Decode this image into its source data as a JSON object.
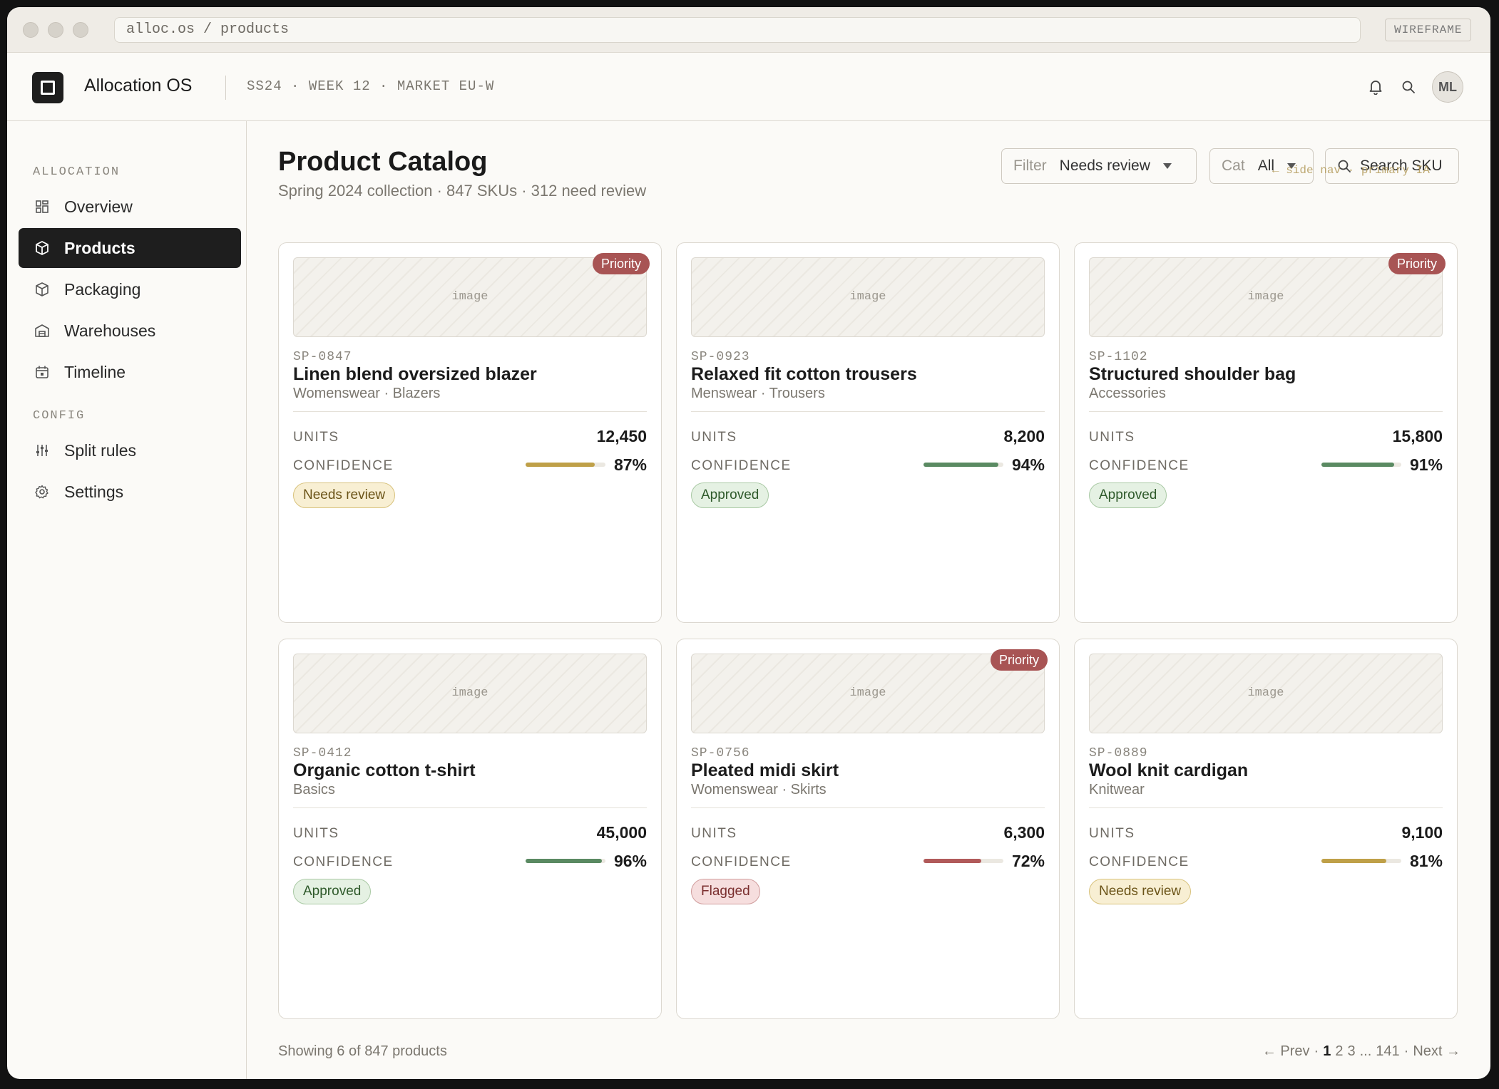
{
  "browser": {
    "url": "alloc.os / products",
    "tag": "WIREFRAME"
  },
  "header": {
    "app_name": "Allocation OS",
    "context": "SS24 · WEEK 12 · MARKET EU-W",
    "avatar_initials": "ML",
    "icons": [
      "bell-icon",
      "search-icon"
    ]
  },
  "sidebar": {
    "sections": [
      {
        "label": "ALLOCATION",
        "items": [
          {
            "label": "Overview",
            "icon": "grid-icon",
            "active": false
          },
          {
            "label": "Products",
            "icon": "box-icon",
            "active": true
          },
          {
            "label": "Packaging",
            "icon": "package-icon",
            "active": false
          },
          {
            "label": "Warehouses",
            "icon": "warehouse-icon",
            "active": false
          },
          {
            "label": "Timeline",
            "icon": "calendar-icon",
            "active": false
          }
        ]
      },
      {
        "label": "CONFIG",
        "items": [
          {
            "label": "Split rules",
            "icon": "sliders-icon",
            "active": false
          },
          {
            "label": "Settings",
            "icon": "gear-icon",
            "active": false
          }
        ]
      }
    ]
  },
  "main": {
    "title": "Product Catalog",
    "subtitle": "Spring 2024 collection · 847 SKUs · 312 need review",
    "filter": {
      "label": "Filter",
      "value": "Needs review"
    },
    "category": {
      "label": "Cat",
      "value": "All"
    },
    "search": {
      "placeholder": "Search SKU"
    },
    "annotation": "← side nav · primary IA",
    "units_label": "UNITS",
    "confidence_label": "CONFIDENCE",
    "image_label": "image",
    "priority_label": "Priority",
    "products": [
      {
        "sku": "SP-0847",
        "name": "Linen blend oversized blazer",
        "category": "Womenswear · Blazers",
        "units": "12,450",
        "confidence": 87,
        "confidence_text": "87%",
        "status": "Needs review",
        "priority": true
      },
      {
        "sku": "SP-0923",
        "name": "Relaxed fit cotton trousers",
        "category": "Menswear · Trousers",
        "units": "8,200",
        "confidence": 94,
        "confidence_text": "94%",
        "status": "Approved",
        "priority": false
      },
      {
        "sku": "SP-1102",
        "name": "Structured shoulder bag",
        "category": "Accessories",
        "units": "15,800",
        "confidence": 91,
        "confidence_text": "91%",
        "status": "Approved",
        "priority": true
      },
      {
        "sku": "SP-0412",
        "name": "Organic cotton t-shirt",
        "category": "Basics",
        "units": "45,000",
        "confidence": 96,
        "confidence_text": "96%",
        "status": "Approved",
        "priority": false
      },
      {
        "sku": "SP-0756",
        "name": "Pleated midi skirt",
        "category": "Womenswear · Skirts",
        "units": "6,300",
        "confidence": 72,
        "confidence_text": "72%",
        "status": "Flagged",
        "priority": true
      },
      {
        "sku": "SP-0889",
        "name": "Wool knit cardigan",
        "category": "Knitwear",
        "units": "9,100",
        "confidence": 81,
        "confidence_text": "81%",
        "status": "Needs review",
        "priority": false
      }
    ],
    "status_colors": {
      "Needs review": {
        "bg": "#f8efd3",
        "border": "#d8c27c",
        "text": "#6b5418",
        "bar": "#bfa048"
      },
      "Approved": {
        "bg": "#e5f1e3",
        "border": "#a9c9a4",
        "text": "#2f5a2b",
        "bar": "#5a8a62"
      },
      "Flagged": {
        "bg": "#f6dede",
        "border": "#d09d9d",
        "text": "#7a2e2e",
        "bar": "#b15a5a"
      }
    }
  },
  "footer": {
    "showing": "Showing 6 of 847 products",
    "prev": "← Prev",
    "sep": "·",
    "pages": [
      "1",
      "2",
      "3",
      "...",
      "141"
    ],
    "current_page": "1",
    "next": "Next →"
  }
}
